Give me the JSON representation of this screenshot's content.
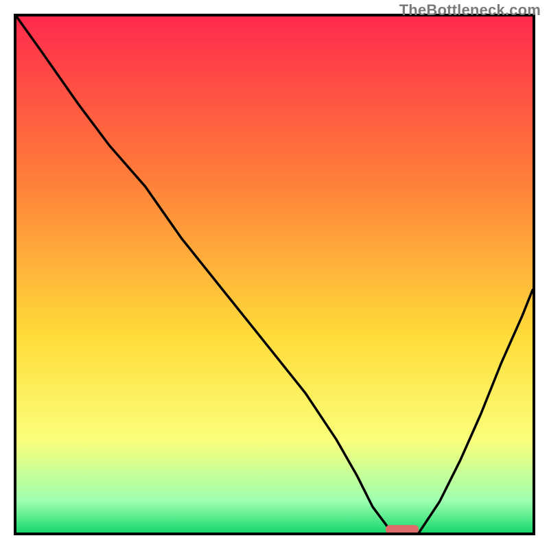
{
  "watermark": "TheBottleneck.com",
  "colors": {
    "gradient_top": "#ff2a4d",
    "gradient_upper_mid": "#ff7a3a",
    "gradient_mid": "#ffdc3a",
    "gradient_lower_mid": "#fbff7a",
    "gradient_green_light": "#9cffb0",
    "gradient_green": "#18d86b",
    "frame_stroke": "#000000",
    "curve_stroke": "#000000",
    "marker_fill": "#e06b6b",
    "marker_stroke": "#e06b6b"
  },
  "chart_data": {
    "type": "line",
    "title": "",
    "xlabel": "",
    "ylabel": "",
    "xlim": [
      0,
      100
    ],
    "ylim": [
      0,
      100
    ],
    "grid": false,
    "legend": null,
    "annotations": [
      {
        "text": "TheBottleneck.com",
        "role": "watermark",
        "position": "top-right"
      }
    ],
    "series": [
      {
        "name": "bottleneck-curve",
        "notes": "Estimated V-shaped valley curve; x = horizontal position percent, y = value percent (0 at bottom / green, 100 at top / red). Values read off the plotted line against the vertical gradient.",
        "x": [
          0,
          5,
          12,
          18,
          25,
          32,
          40,
          48,
          56,
          62,
          66,
          69,
          72,
          75,
          78,
          82,
          86,
          90,
          94,
          98,
          100
        ],
        "y": [
          100,
          93,
          83,
          75,
          67,
          57,
          47,
          37,
          27,
          18,
          11,
          5,
          1,
          0,
          0,
          6,
          14,
          23,
          33,
          42,
          47
        ]
      }
    ],
    "marker": {
      "name": "optimal-point",
      "x": 74,
      "y": 0,
      "shape": "rounded-bar",
      "color": "#e06b6b"
    }
  }
}
